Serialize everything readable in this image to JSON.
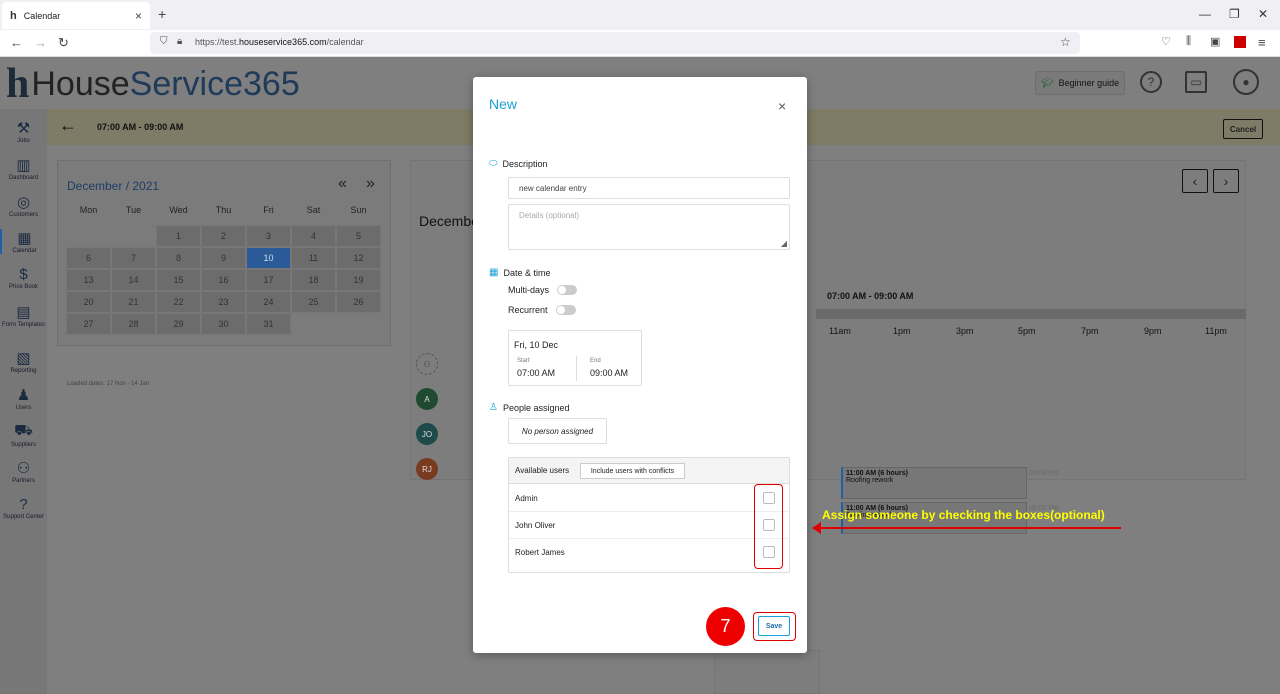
{
  "browser": {
    "tab_title": "Calendar",
    "tab_favicon": "h",
    "tab_close": "×",
    "new_tab": "+",
    "url_prefix": "https://test.",
    "url_domain": "houseservice365.com",
    "url_path": "/calendar",
    "win_min": "—",
    "win_max": "❐",
    "win_close": "✕"
  },
  "app": {
    "logo_h": "h",
    "logo_word1": "House",
    "logo_word2": "Service365",
    "beginner_guide": "Beginner guide",
    "header_range": "07:00 AM - 09:00 AM",
    "cancel_label": "Cancel"
  },
  "sidebar": {
    "items": [
      {
        "label": "Jobs",
        "icon": "⚒"
      },
      {
        "label": "Dashboard",
        "icon": "▥"
      },
      {
        "label": "Customers",
        "icon": "◎"
      },
      {
        "label": "Calendar",
        "icon": "▦"
      },
      {
        "label": "Price Book",
        "icon": "$"
      },
      {
        "label": "Form Templates",
        "icon": "▤"
      },
      {
        "label": "Reporting",
        "icon": "▧"
      },
      {
        "label": "Users",
        "icon": "♟"
      },
      {
        "label": "Suppliers",
        "icon": "⛟"
      },
      {
        "label": "Partners",
        "icon": "⚇"
      },
      {
        "label": "Support Center",
        "icon": "?"
      }
    ]
  },
  "mini_calendar": {
    "title": "December / 2021",
    "prev": "«",
    "next": "»",
    "weekdays": [
      "Mon",
      "Tue",
      "Wed",
      "Thu",
      "Fri",
      "Sat",
      "Sun"
    ],
    "days": [
      "",
      "",
      "1",
      "2",
      "3",
      "4",
      "5",
      "6",
      "7",
      "8",
      "9",
      "10",
      "11",
      "12",
      "13",
      "14",
      "15",
      "16",
      "17",
      "18",
      "19",
      "20",
      "21",
      "22",
      "23",
      "24",
      "25",
      "26",
      "27",
      "28",
      "29",
      "30",
      "31"
    ],
    "selected_day": "10",
    "loaded_dates": "Loaded dates: 17 Nov - 14 Jan"
  },
  "schedule": {
    "title": "December",
    "prev": "‹",
    "next": "›",
    "range": "07:00 AM - 09:00 AM",
    "hours": [
      "11am",
      "1pm",
      "3pm",
      "5pm",
      "7pm",
      "9pm",
      "11pm"
    ],
    "avatars": [
      "A",
      "JO",
      "RJ"
    ],
    "events": [
      {
        "time": "11:00 AM (6 hours)",
        "title": "Roofing rework",
        "end": "05:00 PM"
      },
      {
        "time": "11:00 AM (6 hours)",
        "title": "Roofing rework",
        "end": "05:00 PM"
      }
    ]
  },
  "modal": {
    "title": "New",
    "close": "×",
    "description_label": "Description",
    "description_value": "new calendar entry",
    "details_placeholder": "Details (optional)",
    "datetime_label": "Date & time",
    "multidays_label": "Multi-days",
    "recurrent_label": "Recurrent",
    "date": "Fri, 10 Dec",
    "start_label": "Start",
    "start_value": "07:00 AM",
    "end_label": "End",
    "end_value": "09:00 AM",
    "people_label": "People assigned",
    "no_person": "No person assigned",
    "available_users": "Available users",
    "include_conflicts": "Include users with conflicts",
    "users": [
      "Admin",
      "John Oliver",
      "Robert James"
    ],
    "save_label": "Save"
  },
  "annotation": {
    "step": "7",
    "text": "Assign someone by checking the boxes(optional)"
  },
  "colors": {
    "accent": "#1aa0d8",
    "annotation_red": "#dd0000",
    "annotation_text": "#ffff00"
  }
}
